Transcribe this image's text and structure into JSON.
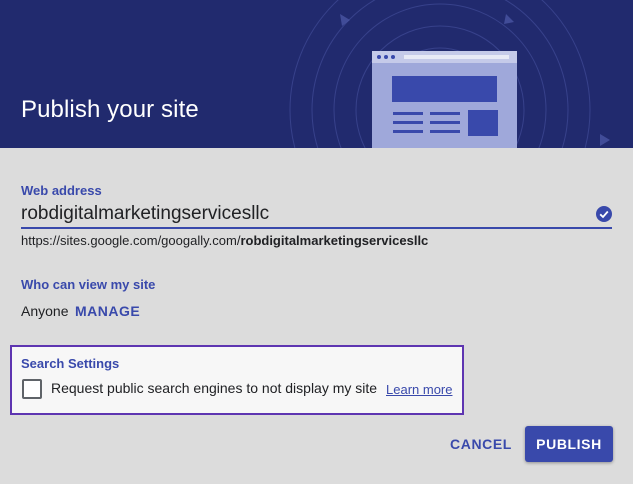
{
  "dialog": {
    "title": "Publish your site"
  },
  "web_address": {
    "label": "Web address",
    "value": "robdigitalmarketingservicesllc",
    "url_prefix": "https://sites.google.com/googally.com/",
    "url_suffix": "robdigitalmarketingservicesllc"
  },
  "viewers": {
    "label": "Who can view my site",
    "value": "Anyone",
    "manage_label": "MANAGE"
  },
  "search_settings": {
    "title": "Search Settings",
    "checkbox_label": "Request public search engines to not display my site",
    "checked": false,
    "learn_more": "Learn more"
  },
  "actions": {
    "cancel_label": "CANCEL",
    "publish_label": "PUBLISH"
  },
  "colors": {
    "header_bg": "#212a6e",
    "accent": "#3949ab",
    "focus_border": "#5e35b1",
    "body_bg": "#dcdcdc"
  },
  "icons": {
    "header_illustration": "website-illustration-icon",
    "valid": "check-circle-icon"
  }
}
